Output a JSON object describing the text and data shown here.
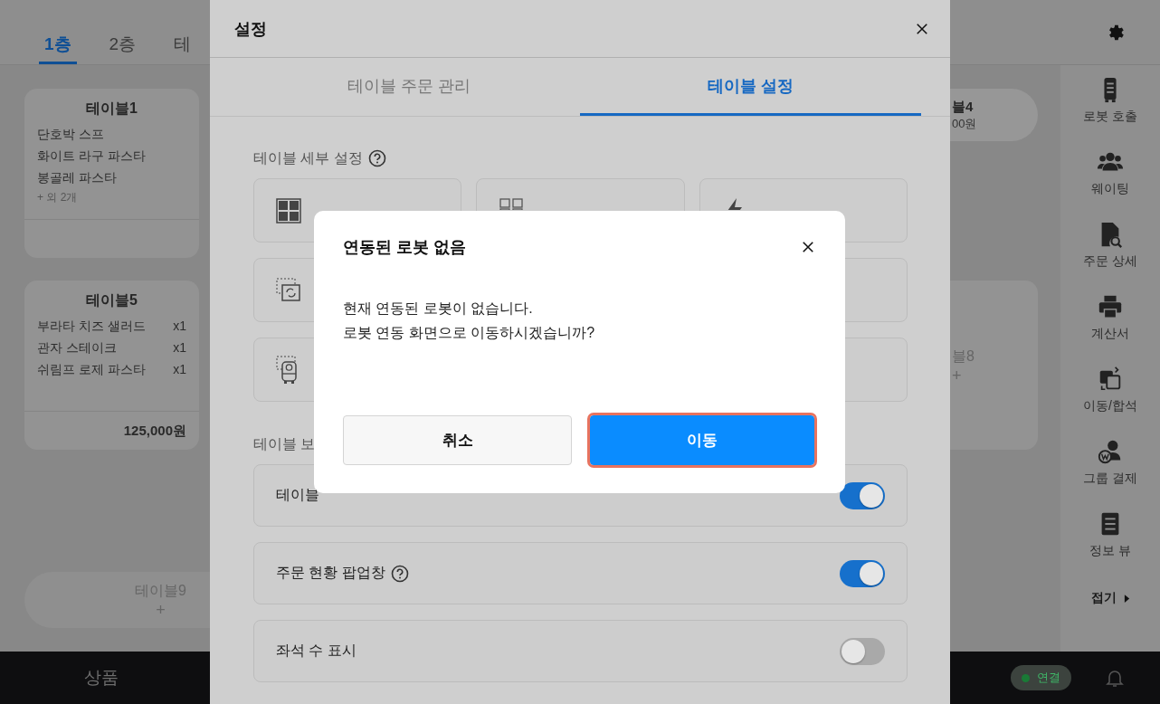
{
  "floor_tabs": [
    {
      "label": "1층",
      "selected": true
    },
    {
      "label": "2층",
      "selected": false
    },
    {
      "label": "테",
      "selected": false
    }
  ],
  "table_rows": [
    {
      "left": {
        "kind": "order",
        "name": "테이블1",
        "items": [
          {
            "name": "단호박 스프"
          },
          {
            "name": "화이트 라구 파스타"
          },
          {
            "name": "봉골레 파스타"
          }
        ],
        "more": "+ 외 2개"
      },
      "right": {
        "kind": "compact",
        "name": "블4",
        "sub": "00원"
      }
    },
    {
      "left": {
        "kind": "order",
        "name": "테이블5",
        "items": [
          {
            "name": "부라타 치즈 샐러드",
            "qty": "x1"
          },
          {
            "name": "관자 스테이크",
            "qty": "x1"
          },
          {
            "name": "쉬림프 로제 파스타",
            "qty": "x1"
          }
        ],
        "total": "125,000원"
      },
      "right": {
        "kind": "vacant",
        "name": "블8",
        "sub": "+"
      }
    },
    {
      "left": {
        "kind": "vacant_pill",
        "name": "테이블9",
        "sub": "+"
      }
    }
  ],
  "sidebar": {
    "items": [
      {
        "label": "로봇 호출"
      },
      {
        "label": "웨이팅"
      },
      {
        "label": "주문 상세"
      },
      {
        "label": "계산서"
      },
      {
        "label": "이동/합석"
      },
      {
        "label": "그룹 결제"
      },
      {
        "label": "정보 뷰"
      }
    ],
    "collapse": "접기"
  },
  "bottom_bar": {
    "tab": "상품",
    "status": "연결"
  },
  "settings": {
    "title": "설정",
    "tabs": [
      {
        "label": "테이블 주문 관리",
        "selected": false
      },
      {
        "label": "테이블 설정",
        "selected": true
      }
    ],
    "detail_section": {
      "title": "테이블 세부 설정",
      "help": true
    },
    "view_section": {
      "title": "테이블 보"
    },
    "toggles": [
      {
        "label": "테이블",
        "on": true
      },
      {
        "label": "주문 현황 팝업창",
        "help": true,
        "on": true
      },
      {
        "label": "좌석 수 표시",
        "on": false
      }
    ]
  },
  "dialog": {
    "title": "연동된 로봇 없음",
    "message": [
      "현재 연동된 로봇이 없습니다.",
      "로봇 연동 화면으로 이동하시겠습니까?"
    ],
    "buttons": [
      {
        "label": "취소",
        "kind": "secondary",
        "highlighted": false
      },
      {
        "label": "이동",
        "kind": "primary",
        "highlighted": true
      }
    ]
  }
}
